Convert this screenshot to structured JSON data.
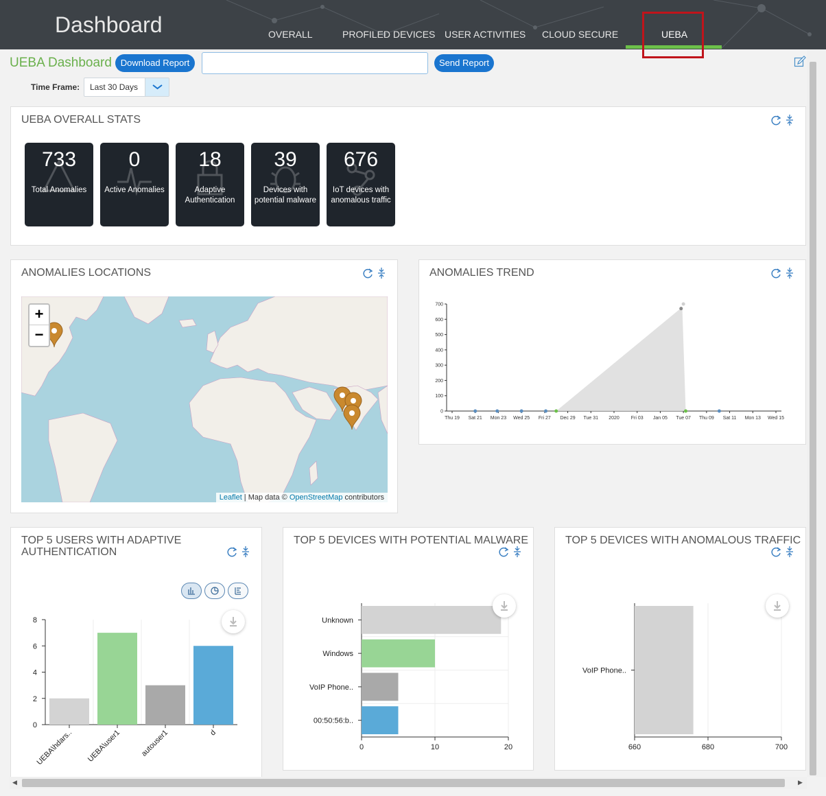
{
  "header": {
    "app_title": "Dashboard",
    "tabs": [
      {
        "label": "OVERALL"
      },
      {
        "label": "PROFILED DEVICES"
      },
      {
        "label": "USER ACTIVITIES"
      },
      {
        "label": "CLOUD SECURE"
      },
      {
        "label": "UEBA"
      }
    ],
    "active_tab": "UEBA"
  },
  "toolbar": {
    "page_title": "UEBA Dashboard",
    "download_label": "Download Report",
    "send_label": "Send Report",
    "report_input_value": "",
    "timeframe_label": "Time Frame:",
    "timeframe_value": "Last 30 Days"
  },
  "colors": {
    "accent_green": "#6cc04a",
    "button_blue": "#1a75cf",
    "highlight_red": "#c0141b",
    "stat_tile": "#1f252c"
  },
  "stats_panel": {
    "title": "UEBA OVERALL STATS",
    "tiles": [
      {
        "value": "733",
        "label": "Total Anomalies",
        "icon": "warning-icon"
      },
      {
        "value": "0",
        "label": "Active Anomalies",
        "icon": "pulse-icon"
      },
      {
        "value": "18",
        "label": "Adaptive Authentication",
        "icon": "lock-icon"
      },
      {
        "value": "39",
        "label": "Devices with potential malware",
        "icon": "bug-icon"
      },
      {
        "value": "676",
        "label": "IoT devices with anomalous traffic",
        "icon": "network-icon"
      }
    ]
  },
  "locations_panel": {
    "title": "ANOMALIES LOCATIONS",
    "zoom_in": "+",
    "zoom_out": "−",
    "attribution_leaflet": "Leaflet",
    "attribution_mid": " | Map data © ",
    "attribution_osm": "OpenStreetMap",
    "attribution_end": " contributors",
    "markers": [
      {
        "place": "North America, east coast",
        "lat": 42,
        "lon": -75
      },
      {
        "place": "India",
        "lat": 23,
        "lon": 72
      },
      {
        "place": "India",
        "lat": 22,
        "lon": 77
      },
      {
        "place": "India",
        "lat": 18,
        "lon": 75
      }
    ]
  },
  "trend_panel": {
    "title": "ANOMALIES TREND"
  },
  "users_panel": {
    "title": "TOP 5 USERS WITH ADAPTIVE AUTHENTICATION"
  },
  "malware_panel": {
    "title": "TOP 5 DEVICES WITH POTENTIAL MALWARE"
  },
  "traffic_panel": {
    "title": "TOP 5 DEVICES WITH ANOMALOUS TRAFFIC"
  },
  "chart_data": [
    {
      "id": "anomalies-trend",
      "type": "area",
      "categories": [
        "Thu 19",
        "Sat 21",
        "Mon 23",
        "Wed 25",
        "Fri 27",
        "Dec 29",
        "Tue 31",
        "2020",
        "Fri 03",
        "Jan 05",
        "Tue 07",
        "Thu 09",
        "Sat 11",
        "Mon 13",
        "Wed 15"
      ],
      "ylim": [
        0,
        700
      ],
      "yticks": [
        0,
        100,
        200,
        300,
        400,
        500,
        600,
        700
      ],
      "points": [
        {
          "x": 1.0,
          "y": 0
        },
        {
          "x": 1.95,
          "y": 0
        },
        {
          "x": 3.0,
          "y": 0
        },
        {
          "x": 4.05,
          "y": 0
        },
        {
          "x": 4.5,
          "y": 0
        },
        {
          "x": 9.9,
          "y": 670
        },
        {
          "x": 10.0,
          "y": 700
        },
        {
          "x": 10.1,
          "y": 0
        },
        {
          "x": 11.55,
          "y": 0
        }
      ],
      "area": [
        [
          4.5,
          0
        ],
        [
          9.95,
          680
        ],
        [
          10.1,
          0
        ]
      ]
    },
    {
      "id": "top-users",
      "type": "bar",
      "categories": [
        "UEBA\\hdars..",
        "UEBA\\user1",
        "autouser1",
        "d"
      ],
      "values": [
        2,
        7,
        3,
        6
      ],
      "colors": [
        "#d3d3d3",
        "#98d595",
        "#a9a9a9",
        "#5aaad8"
      ],
      "ylim": [
        0,
        8
      ],
      "yticks": [
        0,
        2,
        4,
        6,
        8
      ]
    },
    {
      "id": "top-malware",
      "type": "bar",
      "orientation": "horizontal",
      "categories": [
        "Unknown",
        "Windows",
        "VoIP Phone..",
        "00:50:56:b.."
      ],
      "values": [
        19,
        10,
        5,
        5
      ],
      "colors": [
        "#d3d3d3",
        "#98d595",
        "#a9a9a9",
        "#5aaad8"
      ],
      "xlim": [
        0,
        20
      ],
      "xticks": [
        0,
        10,
        20
      ]
    },
    {
      "id": "top-traffic",
      "type": "bar",
      "orientation": "horizontal",
      "categories": [
        "VoIP Phone.."
      ],
      "values": [
        676
      ],
      "colors": [
        "#d3d3d3"
      ],
      "xlim": [
        660,
        700
      ],
      "xticks": [
        660,
        680,
        700
      ]
    }
  ]
}
